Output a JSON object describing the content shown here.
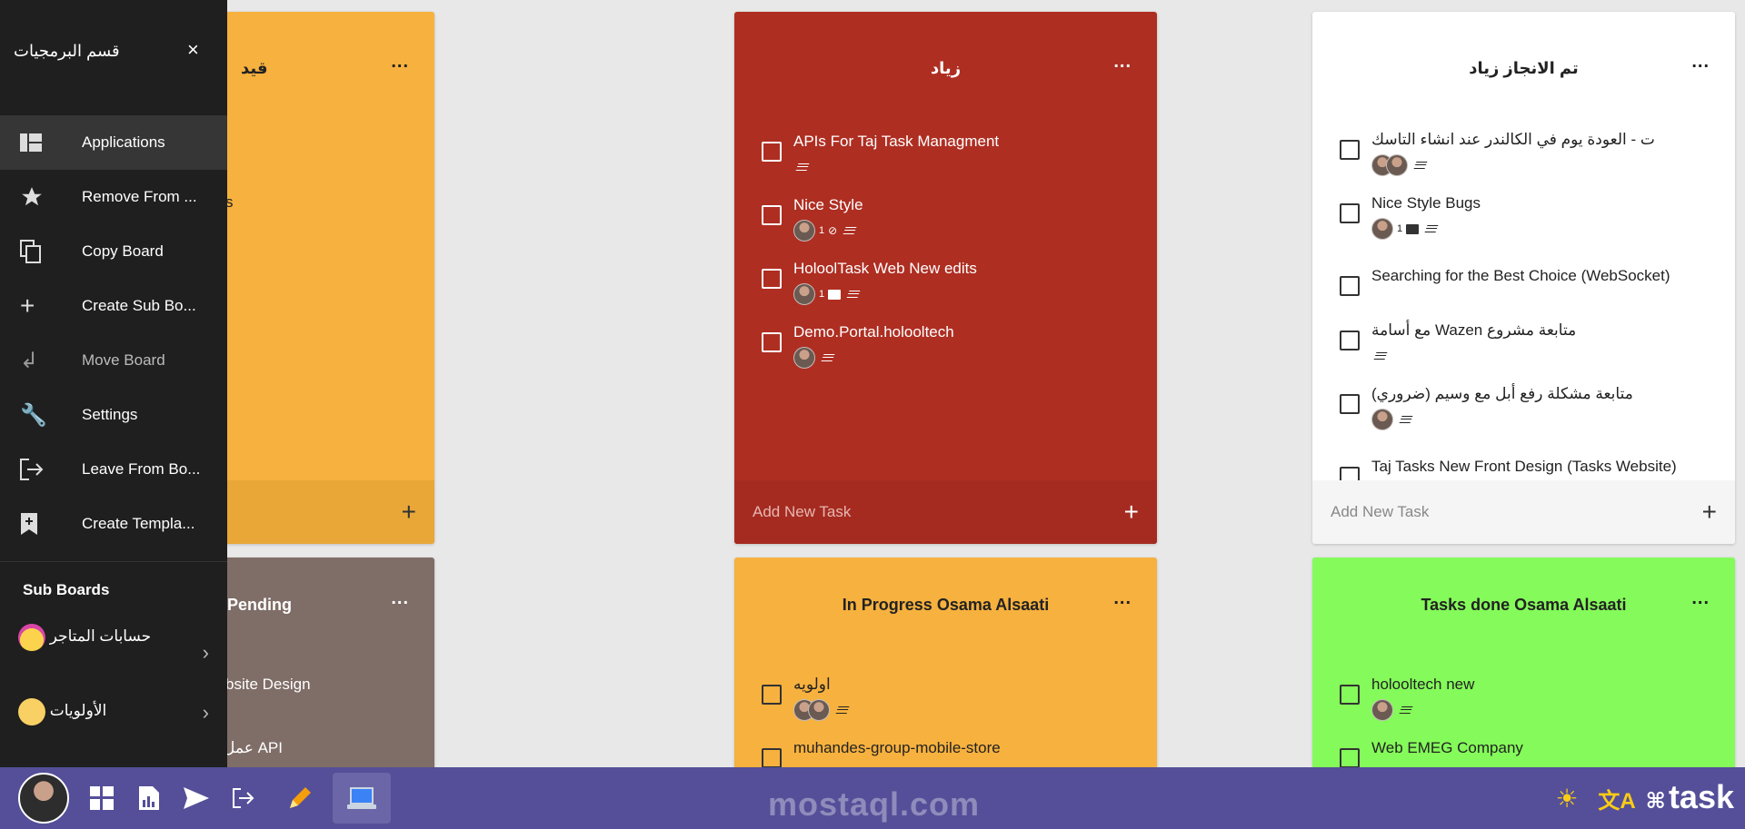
{
  "sidepanel": {
    "title": "قسم البرمجيات",
    "close_icon": "×",
    "menu": [
      {
        "label": "Applications",
        "icon": "dashboard-icon"
      },
      {
        "label": "Remove From ...",
        "icon": "star-icon"
      },
      {
        "label": "Copy Board",
        "icon": "copy-icon"
      },
      {
        "label": "Create Sub Bo...",
        "icon": "plus-icon"
      },
      {
        "label": "Move Board",
        "icon": "return-icon"
      },
      {
        "label": "Settings",
        "icon": "wrench-icon"
      },
      {
        "label": "Leave From Bo...",
        "icon": "exit-icon"
      },
      {
        "label": "Create Templa...",
        "icon": "bookmark-add-icon"
      }
    ],
    "sub_boards_title": "Sub Boards",
    "sub_boards": [
      {
        "label": "حسابات المتاجر",
        "emoji": "star-struck-emoji"
      },
      {
        "label": "الأولويات",
        "emoji": "flushed-emoji"
      }
    ]
  },
  "columns": {
    "c1": {
      "title": "قيد",
      "color": "#f7b13e"
    },
    "c1b": {
      "title": "Pending",
      "color": "#7f6d67",
      "tasks": [
        "bsite Design",
        "عمل API"
      ]
    },
    "c1_partial_text": "s",
    "c2": {
      "title": "زياد",
      "color": "#ae2e22",
      "tasks": [
        {
          "title": "APIs For Taj Task Managment",
          "count": ""
        },
        {
          "title": "Nice Style",
          "count": "1"
        },
        {
          "title": "HoloolTask Web New edits",
          "count": "1"
        },
        {
          "title": "Demo.Portal.holooltech",
          "count": ""
        }
      ],
      "footer": "Add New Task"
    },
    "c3": {
      "title": "تم الانجاز زياد",
      "color": "#ffffff",
      "tasks": [
        {
          "title": "ت - العودة يوم في الكالندر عند انشاء التاسك",
          "count": ""
        },
        {
          "title": "Nice Style Bugs",
          "count": "1"
        },
        {
          "title": "Searching for the Best Choice (WebSocket)",
          "count": ""
        },
        {
          "title": "مع أسامة Wazen متابعة مشروع",
          "count": ""
        },
        {
          "title": "متابعة مشكلة رفع أبل مع وسيم (ضروري)",
          "count": ""
        },
        {
          "title": "Taj Tasks New Front Design (Tasks Website)",
          "count": ""
        }
      ],
      "footer": "Add New Task"
    },
    "c4": {
      "title": "In Progress Osama Alsaati",
      "color": "#f7b13e",
      "tasks": [
        {
          "title": "اولويه"
        },
        {
          "title": "muhandes-group-mobile-store"
        }
      ]
    },
    "c5": {
      "title": "Tasks done Osama Alsaati",
      "color": "#84fb5a",
      "tasks": [
        {
          "title": "holooltech new"
        },
        {
          "title": "Web EMEG Company"
        }
      ]
    },
    "menu_dots": "..."
  },
  "toolbar": {
    "watermark": "mostaql.com",
    "logo": "task",
    "icons": [
      "avatar",
      "dashboard-icon",
      "report-icon",
      "send-icon",
      "logout-icon",
      "pencil-icon",
      "laptop-icon",
      "sun-icon",
      "translate-icon"
    ],
    "toolbar_color": "#544f98"
  }
}
